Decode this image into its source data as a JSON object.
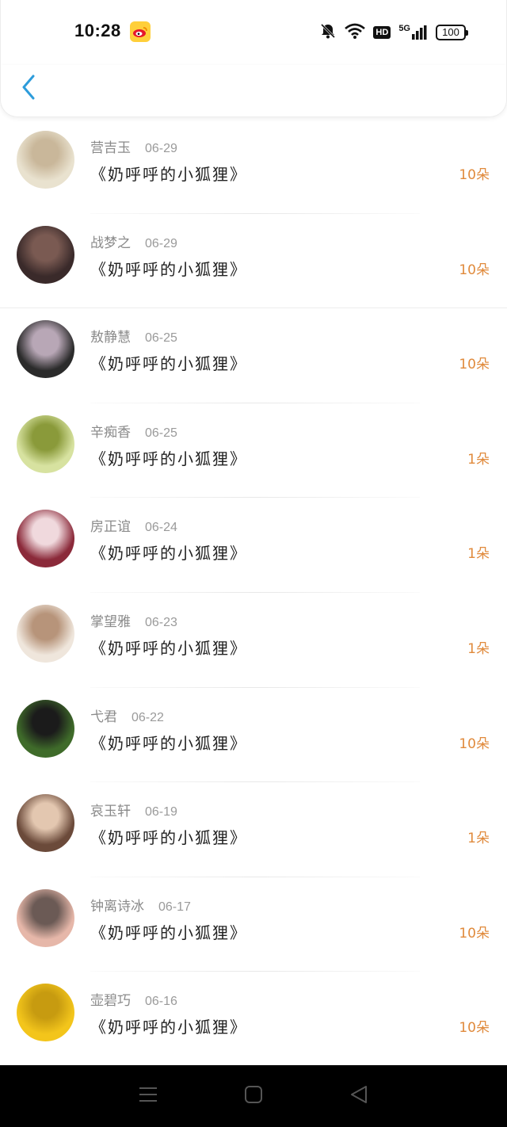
{
  "status_bar": {
    "time": "10:28",
    "network": "5G",
    "hd_label": "HD",
    "battery": "100"
  },
  "header": {
    "back_icon": "chevron-left-icon"
  },
  "rows": [
    {
      "name": "营吉玉",
      "date": "06-29",
      "gift": "《奶呼呼的小狐狸》",
      "count": "10朵",
      "avatar_colors": [
        "#e9e2cf",
        "#c9b79a"
      ]
    },
    {
      "name": "战梦之",
      "date": "06-29",
      "gift": "《奶呼呼的小狐狸》",
      "count": "10朵",
      "avatar_colors": [
        "#3a2a2a",
        "#7a5a52"
      ]
    },
    {
      "name": "敖静慧",
      "date": "06-25",
      "gift": "《奶呼呼的小狐狸》",
      "count": "10朵",
      "avatar_colors": [
        "#2b2b2b",
        "#b8a7b6"
      ]
    },
    {
      "name": "辛痴香",
      "date": "06-25",
      "gift": "《奶呼呼的小狐狸》",
      "count": "1朵",
      "avatar_colors": [
        "#d7e2a0",
        "#8a9a3a"
      ]
    },
    {
      "name": "房正谊",
      "date": "06-24",
      "gift": "《奶呼呼的小狐狸》",
      "count": "1朵",
      "avatar_colors": [
        "#8b2a3a",
        "#f0d9dd"
      ]
    },
    {
      "name": "掌望雅",
      "date": "06-23",
      "gift": "《奶呼呼的小狐狸》",
      "count": "1朵",
      "avatar_colors": [
        "#efe6dc",
        "#b7947a"
      ]
    },
    {
      "name": "弋君",
      "date": "06-22",
      "gift": "《奶呼呼的小狐狸》",
      "count": "10朵",
      "avatar_colors": [
        "#3f6b2a",
        "#1b1b1b"
      ]
    },
    {
      "name": "哀玉轩",
      "date": "06-19",
      "gift": "《奶呼呼的小狐狸》",
      "count": "1朵",
      "avatar_colors": [
        "#6b4a3a",
        "#e3c7b0"
      ]
    },
    {
      "name": "钟离诗冰",
      "date": "06-17",
      "gift": "《奶呼呼的小狐狸》",
      "count": "10朵",
      "avatar_colors": [
        "#e6b7a9",
        "#6b5a55"
      ]
    },
    {
      "name": "壶碧巧",
      "date": "06-16",
      "gift": "《奶呼呼的小狐狸》",
      "count": "10朵",
      "avatar_colors": [
        "#f3c51b",
        "#c79b10"
      ]
    }
  ],
  "colors": {
    "accent": "#2d9cdb",
    "count": "#e08a3c",
    "name": "#8a8a8a"
  }
}
